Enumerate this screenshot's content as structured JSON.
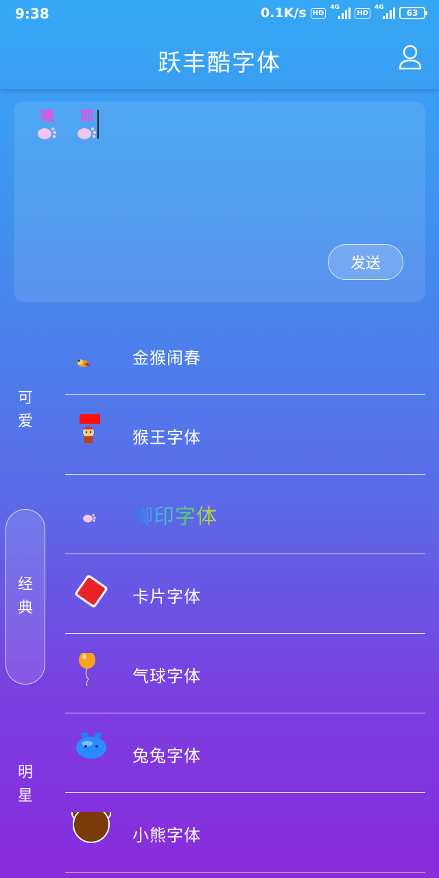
{
  "status_bar": {
    "time": "9:38",
    "speed": "0.1K/s",
    "hd1": "HD",
    "net1": "4G",
    "hd2": "HD",
    "net2": "4G",
    "battery": "63"
  },
  "header": {
    "title": "跃丰酷字体",
    "user_icon": "user-icon"
  },
  "editor": {
    "chars": [
      "噢",
      "耶"
    ],
    "send_label": "发送"
  },
  "side_tabs": [
    {
      "label": [
        "可",
        "爱"
      ],
      "active": false
    },
    {
      "label": [
        "经",
        "典"
      ],
      "active": true
    },
    {
      "label": [
        "明",
        "星"
      ],
      "active": false
    }
  ],
  "fonts": [
    {
      "label": "金猴闹春",
      "icon": "monkey-flying-icon"
    },
    {
      "label": "猴王字体",
      "icon": "monkey-king-icon"
    },
    {
      "label": "脚印字体",
      "icon": "paw-print-icon"
    },
    {
      "label": "卡片字体",
      "icon": "red-card-icon"
    },
    {
      "label": "气球字体",
      "icon": "balloon-icon"
    },
    {
      "label": "兔兔字体",
      "icon": "bunny-icon"
    },
    {
      "label": "小熊字体",
      "icon": "bear-icon"
    }
  ],
  "colors": {
    "gradient_top": "#35a8f5",
    "gradient_bottom": "#8a2bdc",
    "glyph_pink": "#e64fe0"
  }
}
